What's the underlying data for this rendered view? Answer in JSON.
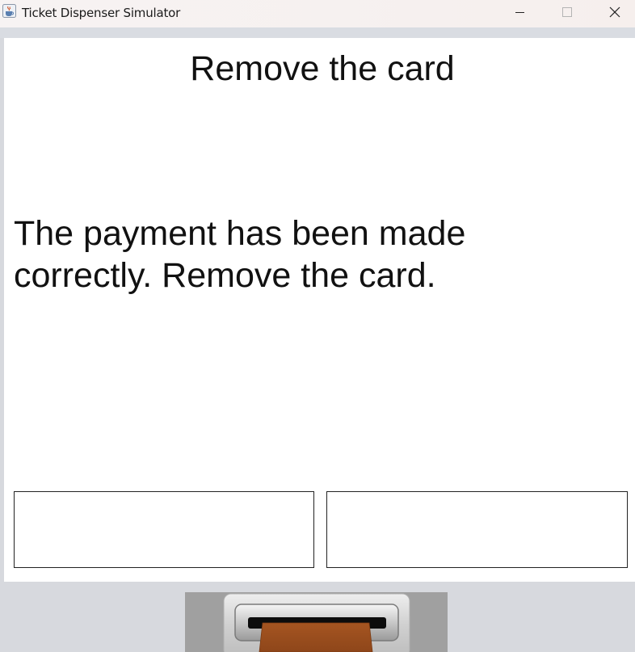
{
  "window": {
    "title": "Ticket Dispenser Simulator",
    "icon": "java-cup-icon",
    "controls": [
      "minimize-icon",
      "maximize-icon",
      "close-icon"
    ]
  },
  "screen": {
    "title": "Remove the card",
    "message": "The payment has been made correctly. Remove the card."
  },
  "card_reader": {
    "card_color": "#9c4f1f"
  }
}
